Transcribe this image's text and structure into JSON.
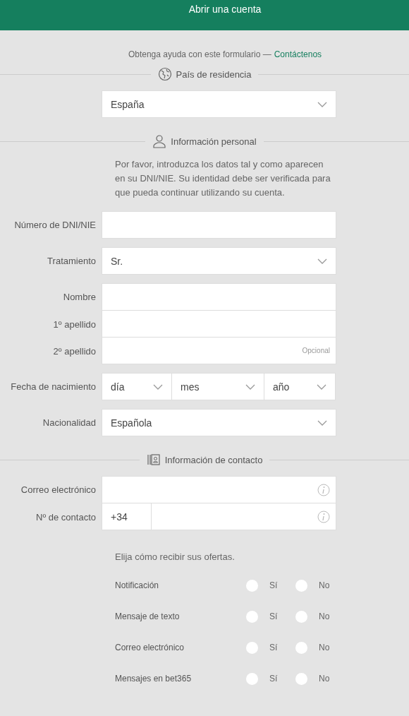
{
  "header": {
    "title": "Abrir una cuenta"
  },
  "help": {
    "text": "Obtenga ayuda con este formulario —",
    "link": "Contáctenos"
  },
  "sections": [
    {
      "title": "País de residencia",
      "rows": [
        {
          "kind": "select",
          "value": "España"
        }
      ]
    },
    {
      "title": "Información personal",
      "rows": [
        {
          "kind": "note",
          "text": "Por favor, introduzca los datos tal y como aparecen en su DNI/NIE. Su identidad debe ser verificada para que pueda continuar utilizando su cuenta."
        },
        {
          "kind": "text",
          "label": "Número de DNI/NIE"
        },
        {
          "kind": "select",
          "label": "Tratamiento",
          "value": "Sr."
        },
        {
          "kind": "group",
          "fields": [
            {
              "label": "Nombre"
            },
            {
              "label": "1º apellido"
            },
            {
              "label": "2º apellido",
              "hint": "Opcional"
            }
          ]
        },
        {
          "kind": "date",
          "label": "Fecha de nacimiento",
          "parts": [
            "día",
            "mes",
            "año"
          ]
        },
        {
          "kind": "select",
          "label": "Nacionalidad",
          "value": "Española"
        }
      ]
    },
    {
      "title": "Información de contacto",
      "rows": [
        {
          "kind": "group",
          "fields": [
            {
              "label": "Correo electrónico",
              "info": true
            },
            {
              "label": "Nº de contacto",
              "prefix": "+34",
              "info": true
            }
          ]
        },
        {
          "kind": "note",
          "text": "Elija cómo recibir sus ofertas."
        },
        {
          "kind": "radio",
          "label": "Notificación",
          "options": [
            {
              "label": "Sí",
              "selected": false
            },
            {
              "label": "No",
              "selected": false
            }
          ]
        },
        {
          "kind": "radio",
          "label": "Mensaje de texto",
          "options": [
            {
              "label": "Sí",
              "selected": false
            },
            {
              "label": "No",
              "selected": false
            }
          ]
        },
        {
          "kind": "radio",
          "label": "Correo electrónico",
          "options": [
            {
              "label": "Sí",
              "selected": false
            },
            {
              "label": "No",
              "selected": false
            }
          ]
        },
        {
          "kind": "radio",
          "label": "Mensajes en bet365",
          "options": [
            {
              "label": "Sí",
              "selected": false
            },
            {
              "label": "No",
              "selected": false
            }
          ]
        }
      ]
    }
  ]
}
